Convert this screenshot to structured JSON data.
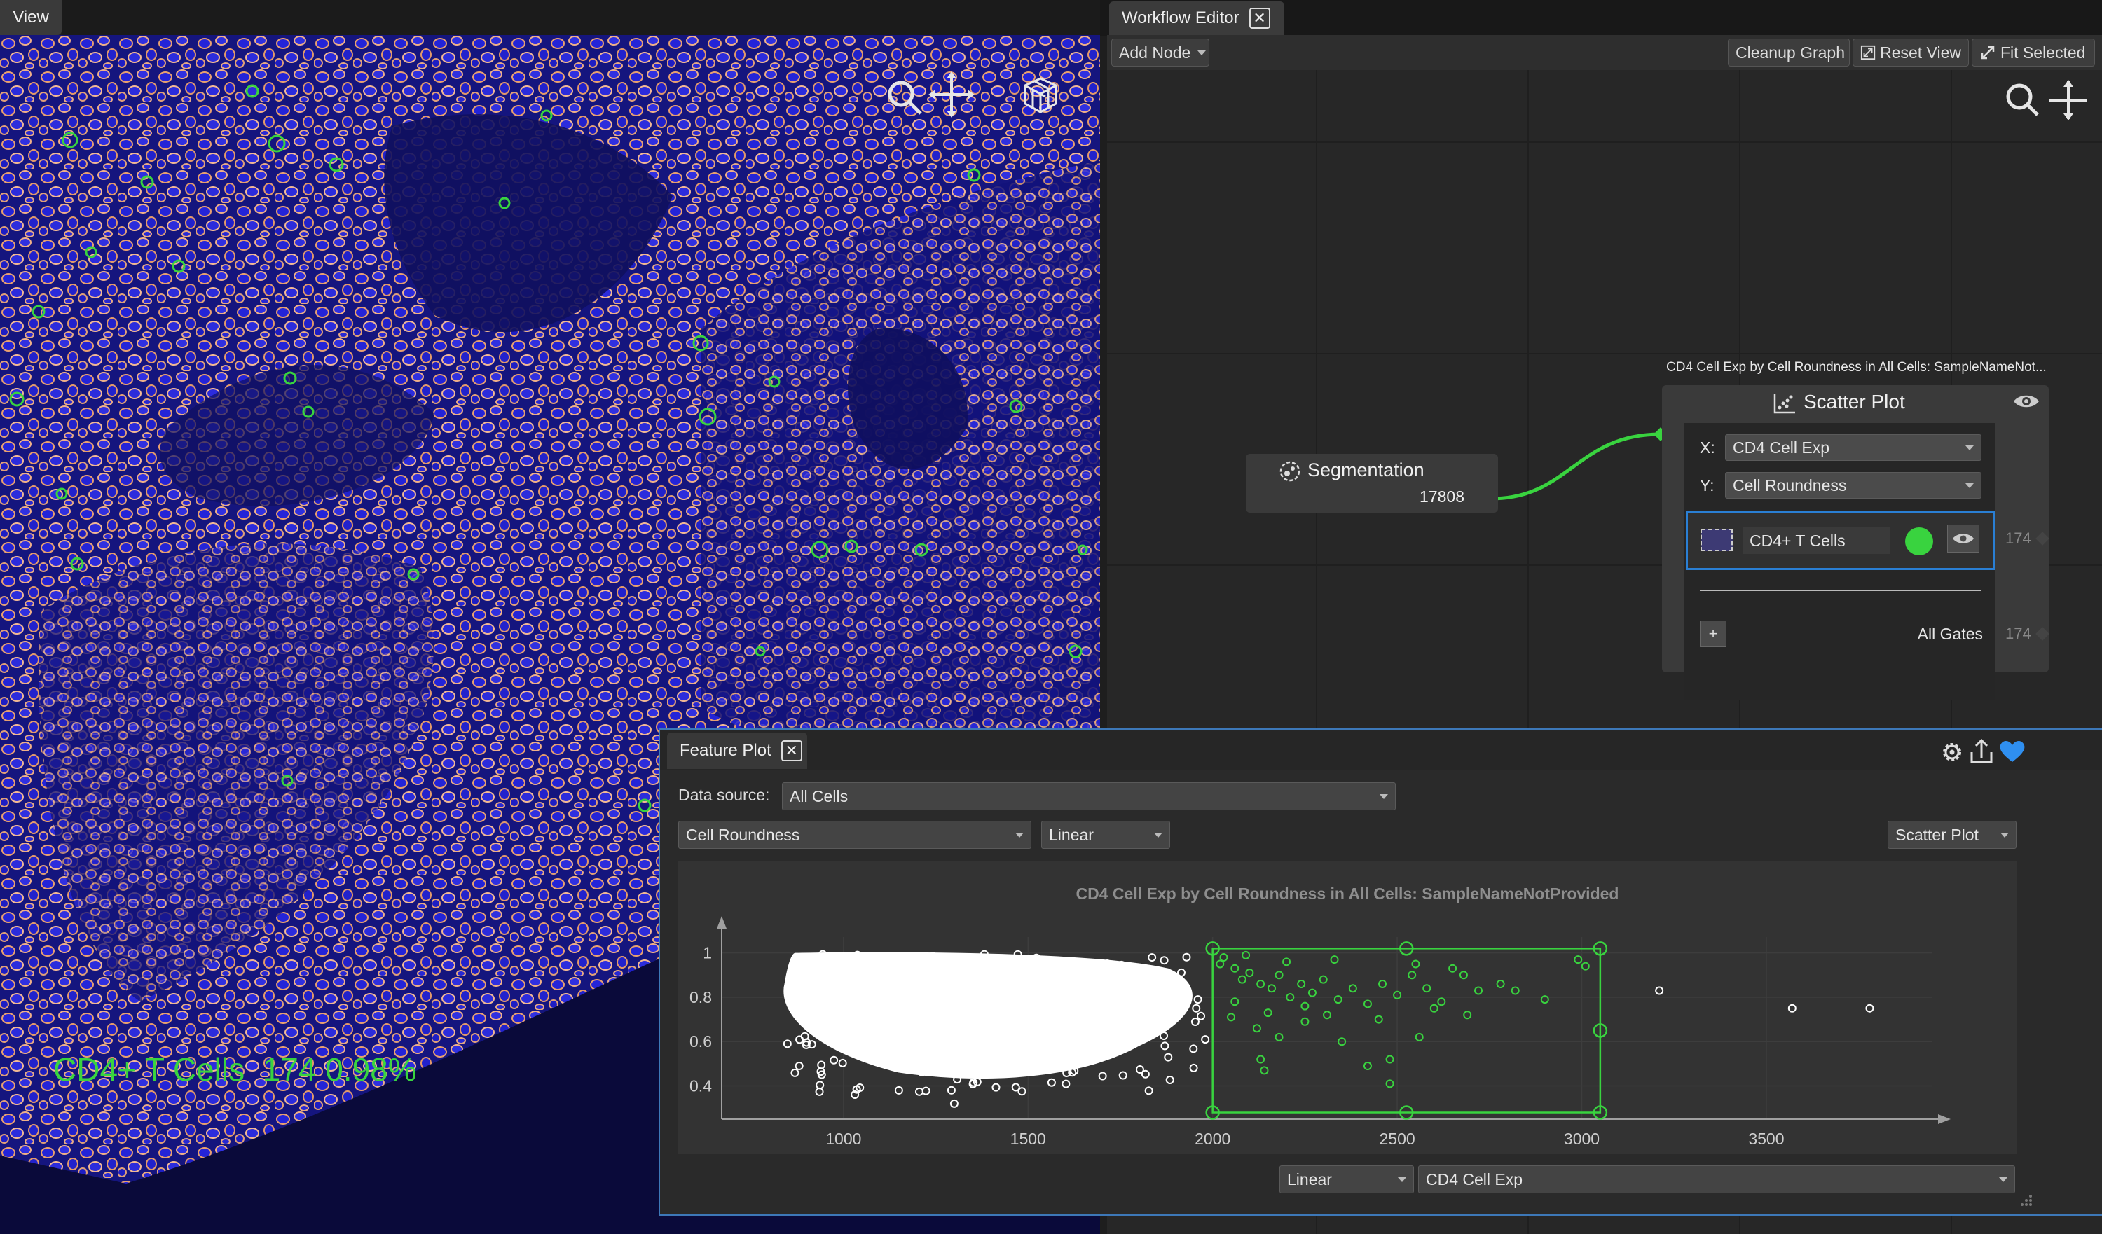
{
  "view": {
    "tab_label": "View",
    "readout": {
      "label": "CD4+ T Cells",
      "count": "174",
      "percent": "0.98%"
    }
  },
  "colors": {
    "accent_green": "#39d33f",
    "tissue_blue": "#1a1aa8",
    "selection_blue": "#2a7fd4",
    "heart_blue": "#2f8ff0"
  },
  "icons": {
    "view_tools": [
      "magnifier-icon",
      "pan-cross-icon",
      "cube-3d-icon"
    ],
    "workflow_tools": [
      "magnifier-icon",
      "pan-cross-icon"
    ],
    "feature_plot_tools": [
      "gear-icon",
      "export-icon",
      "heart-icon"
    ]
  },
  "workflow": {
    "tab_label": "Workflow Editor",
    "add_node": "Add Node",
    "cleanup_graph": "Cleanup Graph",
    "reset_view": "Reset View",
    "fit_selected": "Fit Selected",
    "segmentation_node": {
      "title": "Segmentation",
      "count": "17808"
    },
    "scatter_node": {
      "caption": "CD4 Cell Exp by Cell Roundness in All Cells: SampleNameNot...",
      "title": "Scatter Plot",
      "x_label": "X:",
      "x_value": "CD4 Cell Exp",
      "y_label": "Y:",
      "y_value": "Cell Roundness",
      "gate_name": "CD4+ T Cells",
      "gate_count": "174",
      "add_label": "+",
      "all_gates_label": "All Gates",
      "all_gates_count": "174"
    }
  },
  "feature_plot": {
    "tab_label": "Feature Plot",
    "data_source_label": "Data source:",
    "data_source_value": "All Cells",
    "y_feature": "Cell Roundness",
    "y_scale": "Linear",
    "plot_type": "Scatter Plot",
    "x_scale": "Linear",
    "x_feature": "CD4 Cell Exp"
  },
  "chart_data": {
    "type": "scatter",
    "title": "CD4 Cell Exp by Cell Roundness in All Cells: SampleNameNotProvided",
    "xlabel": "",
    "ylabel": "",
    "xlim": [
      670,
      3950
    ],
    "ylim": [
      0.25,
      1.04
    ],
    "x_ticks": [
      1000,
      1500,
      2000,
      2500,
      3000,
      3500
    ],
    "y_ticks": [
      0.4,
      0.6,
      0.8,
      1
    ],
    "grid": true,
    "gate": {
      "x": [
        2000,
        3050
      ],
      "y": [
        0.28,
        1.02
      ]
    },
    "series": [
      {
        "color": "#ffffff",
        "points": [
          [
            3210,
            0.83
          ],
          [
            3570,
            0.75
          ],
          [
            3780,
            0.75
          ],
          [
            1980,
            0.61
          ],
          [
            1960,
            0.79
          ],
          [
            880,
            0.49
          ],
          [
            1150,
            0.38
          ],
          [
            1300,
            0.32
          ]
        ]
      },
      {
        "color": "#39d33f",
        "points": [
          [
            2030,
            0.98
          ],
          [
            2060,
            0.93
          ],
          [
            2080,
            0.88
          ],
          [
            2100,
            0.91
          ],
          [
            2130,
            0.86
          ],
          [
            2160,
            0.84
          ],
          [
            2180,
            0.9
          ],
          [
            2210,
            0.8
          ],
          [
            2240,
            0.86
          ],
          [
            2270,
            0.82
          ],
          [
            2300,
            0.88
          ],
          [
            2340,
            0.79
          ],
          [
            2380,
            0.84
          ],
          [
            2420,
            0.77
          ],
          [
            2460,
            0.86
          ],
          [
            2500,
            0.81
          ],
          [
            2540,
            0.9
          ],
          [
            2580,
            0.84
          ],
          [
            2620,
            0.78
          ],
          [
            2680,
            0.9
          ],
          [
            2720,
            0.83
          ],
          [
            2780,
            0.86
          ],
          [
            2820,
            0.83
          ],
          [
            2900,
            0.79
          ],
          [
            2050,
            0.71
          ],
          [
            2120,
            0.66
          ],
          [
            2180,
            0.62
          ],
          [
            2250,
            0.69
          ],
          [
            2350,
            0.6
          ],
          [
            2450,
            0.7
          ],
          [
            2560,
            0.62
          ],
          [
            2690,
            0.72
          ],
          [
            2130,
            0.52
          ],
          [
            2140,
            0.47
          ],
          [
            2420,
            0.49
          ],
          [
            2480,
            0.52
          ],
          [
            2480,
            0.41
          ],
          [
            2020,
            0.95
          ],
          [
            2090,
            0.99
          ],
          [
            2200,
            0.96
          ],
          [
            2330,
            0.97
          ],
          [
            2550,
            0.95
          ],
          [
            2650,
            0.93
          ],
          [
            2990,
            0.97
          ],
          [
            3010,
            0.94
          ],
          [
            2250,
            0.76
          ],
          [
            2150,
            0.73
          ],
          [
            2600,
            0.75
          ],
          [
            2060,
            0.78
          ],
          [
            2310,
            0.72
          ]
        ]
      }
    ]
  }
}
